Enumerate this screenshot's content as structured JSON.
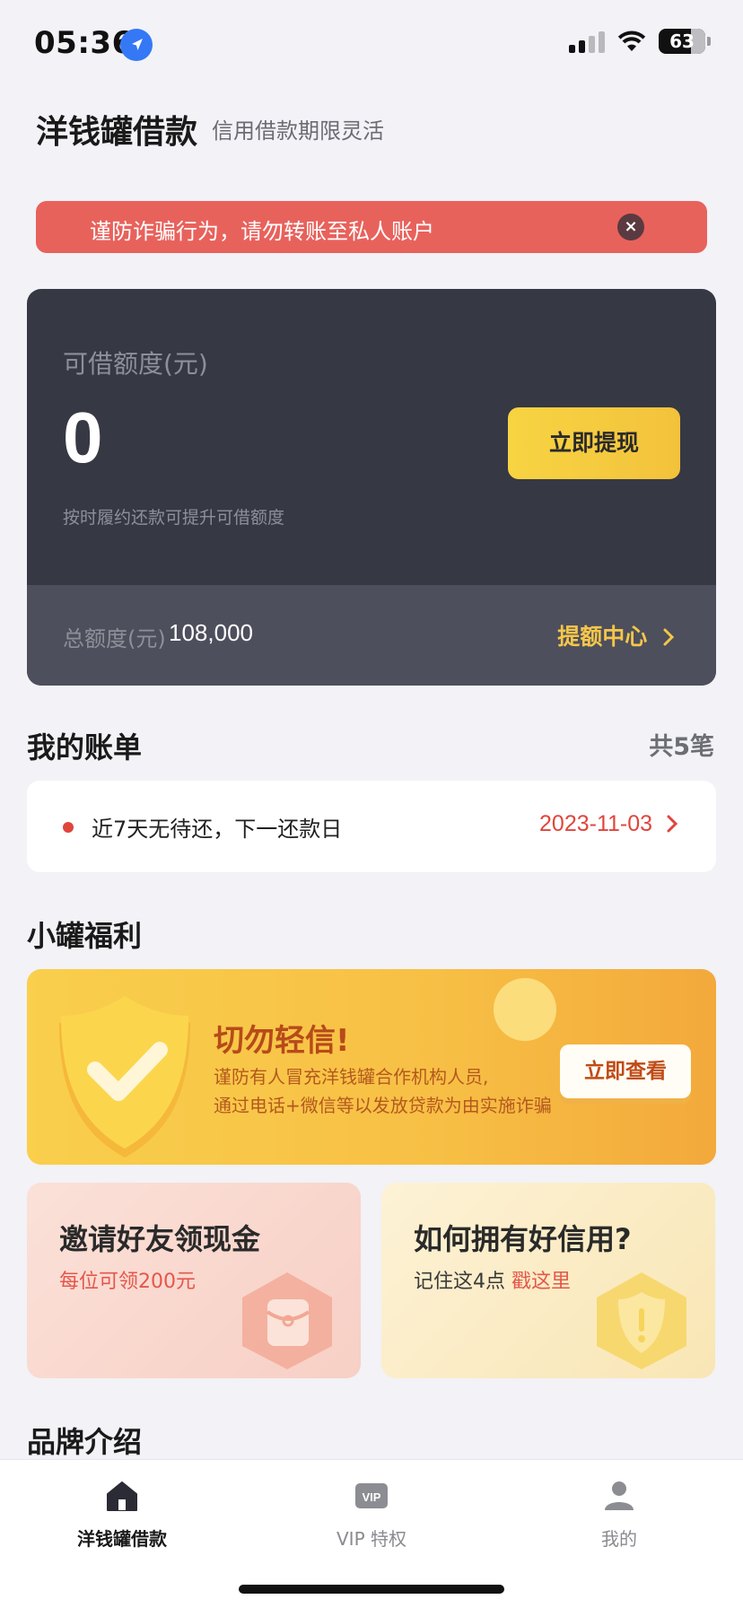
{
  "status_bar": {
    "time": "05:36",
    "battery": "63"
  },
  "header": {
    "title": "洋钱罐借款",
    "subtitle": "信用借款期限灵活"
  },
  "warning": {
    "text": "谨防诈骗行为，请勿转账至私人账户",
    "close_glyph": "×"
  },
  "credit": {
    "label": "可借额度(元)",
    "amount": "0",
    "hint": "按时履约还款可提升可借额度",
    "withdraw_label": "立即提现",
    "total_label": "总额度(元)",
    "total_value": "108,000",
    "center_link": "提额中心"
  },
  "bills": {
    "title": "我的账单",
    "count": "共5笔",
    "item_text": "近7天无待还，下一还款日",
    "item_date": "2023-11-03"
  },
  "benefits": {
    "title": "小罐福利",
    "banner_title": "切勿轻信!",
    "banner_line1": "谨防有人冒充洋钱罐合作机构人员,",
    "banner_line2": "通过电话+微信等以发放贷款为由实施诈骗",
    "banner_button": "立即查看"
  },
  "cards": {
    "invite_title": "邀请好友领现金",
    "invite_sub": "每位可领200元",
    "credit_title": "如何拥有好信用?",
    "credit_sub": "记住这4点",
    "credit_link": "戳这里"
  },
  "brand": {
    "title": "品牌介绍"
  },
  "tabbar": {
    "tabs": [
      {
        "label": "洋钱罐借款",
        "icon": "home-icon"
      },
      {
        "label": "VIP 特权",
        "icon": "vip-icon"
      },
      {
        "label": "我的",
        "icon": "user-icon"
      }
    ]
  },
  "colors": {
    "accent_yellow": "#f6c64a",
    "warning_red": "#e8625c",
    "card_dark": "#363844"
  }
}
